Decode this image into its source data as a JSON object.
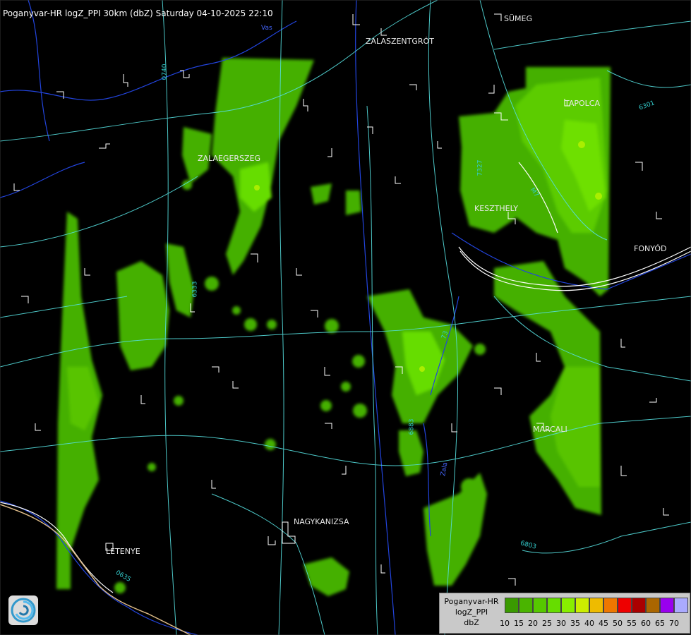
{
  "title": "Poganyvar-HR logZ_PPI 30km (dbZ) Saturday 04-10-2025 22:10",
  "cities": [
    {
      "key": "sumeg",
      "label": "SÜMEG"
    },
    {
      "key": "zalaszentgrot",
      "label": "ZALASZENTGRÓT"
    },
    {
      "key": "tapolca",
      "label": "TAPOLCA"
    },
    {
      "key": "zalaegerszeg",
      "label": "ZALAEGERSZEG"
    },
    {
      "key": "keszthely",
      "label": "KESZTHELY"
    },
    {
      "key": "fonyod",
      "label": "FONYÓD"
    },
    {
      "key": "marcali",
      "label": "MARCALI"
    },
    {
      "key": "nagykanizsa",
      "label": "NAGYKANIZSA"
    },
    {
      "key": "letenye",
      "label": "LETENYE"
    }
  ],
  "roads": [
    "0740",
    "6301",
    "7327",
    "6333",
    "6883",
    "6803",
    "0635",
    "M7",
    "Zala",
    "73",
    "Vas"
  ],
  "legend": {
    "label_lines": [
      "Poganyvar-HR",
      "logZ_PPI",
      "dbZ"
    ],
    "ticks": [
      "10",
      "15",
      "20",
      "25",
      "30",
      "35",
      "40",
      "45",
      "50",
      "55",
      "60",
      "65",
      "70"
    ],
    "colors": [
      "#3a9a00",
      "#4ab400",
      "#56c800",
      "#66dd00",
      "#88ee00",
      "#ccee00",
      "#eebb00",
      "#ee7700",
      "#ee0000",
      "#aa0000",
      "#aa6600",
      "#9900ee",
      "#aaaaff"
    ]
  },
  "icons": {
    "logo": "radar-logo-icon"
  }
}
